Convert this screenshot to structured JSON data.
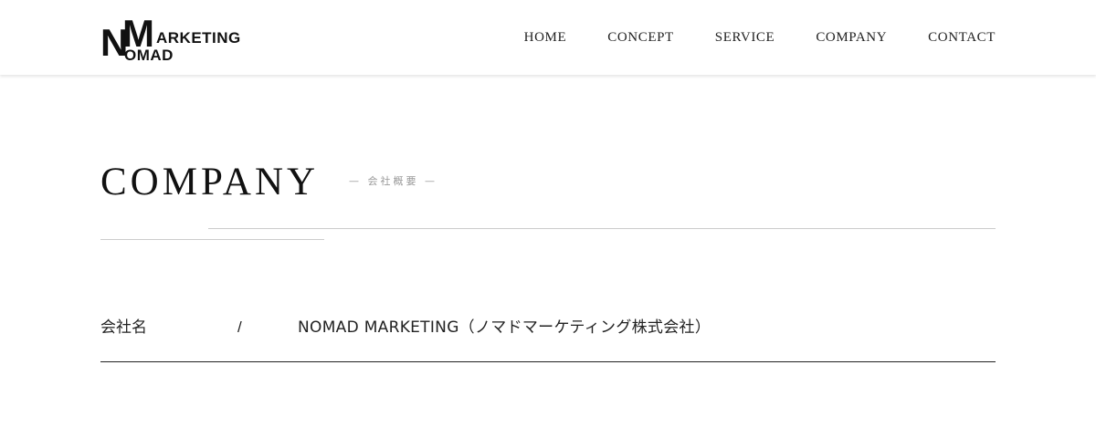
{
  "header": {
    "logo": {
      "letter_n": "N",
      "letter_m": "M",
      "top_text": "ARKETING",
      "bottom_text": "OMAD"
    },
    "nav": [
      {
        "label": "HOME"
      },
      {
        "label": "CONCEPT"
      },
      {
        "label": "SERVICE"
      },
      {
        "label": "COMPANY"
      },
      {
        "label": "CONTACT"
      }
    ]
  },
  "section": {
    "title": "COMPANY",
    "subtitle": "— 会社概要 —"
  },
  "info": {
    "rows": [
      {
        "label": "会社名",
        "separator": "/",
        "value": "NOMAD MARKETING（ノマドマーケティング株式会社）"
      }
    ]
  },
  "colors": {
    "text": "#111111",
    "nav_text": "#222222",
    "subtitle": "#999999",
    "rule": "#cccccc",
    "row_border": "#222222",
    "background": "#ffffff"
  }
}
